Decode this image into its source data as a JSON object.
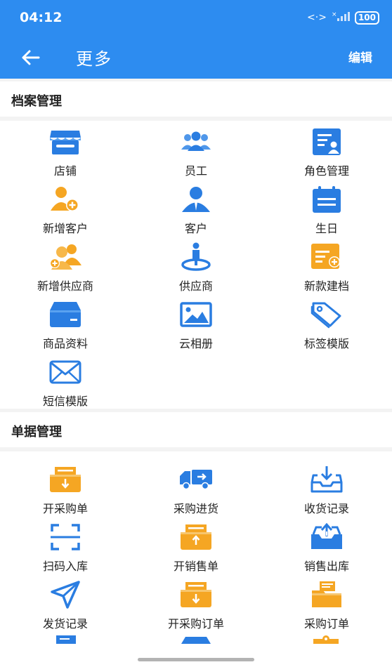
{
  "status_bar": {
    "time": "04:12",
    "battery": "100"
  },
  "app_bar": {
    "title": "更多",
    "edit_label": "编辑"
  },
  "colors": {
    "primary": "#2d8cf0",
    "accent": "#f5a623",
    "icon_blue": "#2a7de1"
  },
  "sections": [
    {
      "title": "档案管理",
      "items": [
        {
          "label": "店铺",
          "icon": "store-icon"
        },
        {
          "label": "员工",
          "icon": "staff-icon"
        },
        {
          "label": "角色管理",
          "icon": "role-card-icon"
        },
        {
          "label": "新增客户",
          "icon": "add-customer-icon"
        },
        {
          "label": "客户",
          "icon": "customer-icon"
        },
        {
          "label": "生日",
          "icon": "calendar-icon"
        },
        {
          "label": "新增供应商",
          "icon": "add-supplier-icon"
        },
        {
          "label": "供应商",
          "icon": "supplier-location-icon"
        },
        {
          "label": "新款建档",
          "icon": "new-item-doc-icon"
        },
        {
          "label": "商品资料",
          "icon": "product-box-icon"
        },
        {
          "label": "云相册",
          "icon": "photo-album-icon"
        },
        {
          "label": "标签模版",
          "icon": "tag-icon"
        },
        {
          "label": "短信模版",
          "icon": "envelope-icon"
        }
      ]
    },
    {
      "title": "单据管理",
      "items": [
        {
          "label": "开采购单",
          "icon": "purchase-order-icon"
        },
        {
          "label": "采购进货",
          "icon": "delivery-truck-icon"
        },
        {
          "label": "收货记录",
          "icon": "inbox-download-icon"
        },
        {
          "label": "扫码入库",
          "icon": "scan-icon"
        },
        {
          "label": "开销售单",
          "icon": "sales-order-icon"
        },
        {
          "label": "销售出库",
          "icon": "outbox-upload-icon"
        },
        {
          "label": "发货记录",
          "icon": "send-icon"
        },
        {
          "label": "开采购订单",
          "icon": "purchase-booking-icon"
        },
        {
          "label": "采购订单",
          "icon": "folder-doc-icon"
        }
      ]
    }
  ]
}
